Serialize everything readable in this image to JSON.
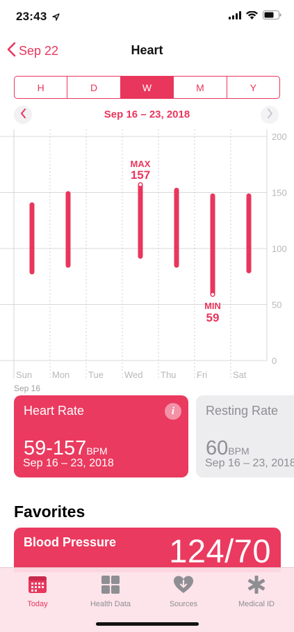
{
  "status_bar": {
    "time": "23:43",
    "icons": [
      "location-arrow-icon",
      "signal-bars-icon",
      "wifi-icon",
      "battery-icon"
    ]
  },
  "nav": {
    "back_label": "Sep 22",
    "title": "Heart"
  },
  "segments": [
    {
      "label": "H",
      "active": false
    },
    {
      "label": "D",
      "active": false
    },
    {
      "label": "W",
      "active": true
    },
    {
      "label": "M",
      "active": false
    },
    {
      "label": "Y",
      "active": false
    }
  ],
  "date_range": {
    "label": "Sep 16 – 23, 2018"
  },
  "accent_color": "#e8365d",
  "chart_data": {
    "type": "range-bar",
    "categories": [
      "Sun",
      "Mon",
      "Tue",
      "Wed",
      "Thu",
      "Fri",
      "Sat"
    ],
    "lows": [
      79,
      85,
      null,
      93,
      85,
      59,
      80
    ],
    "highs": [
      139,
      149,
      null,
      157,
      152,
      147,
      147
    ],
    "ylim": [
      0,
      200
    ],
    "yticks": [
      0,
      50,
      100,
      150,
      200
    ],
    "grid": true,
    "max_annotation": {
      "label": "MAX",
      "value": 157,
      "category": "Wed"
    },
    "min_annotation": {
      "label": "MIN",
      "value": 59,
      "category": "Fri"
    },
    "x_caption": "Sep 16"
  },
  "cards": {
    "heart_rate": {
      "title": "Heart Rate",
      "value": "59-157",
      "unit": "BPM",
      "date": "Sep 16 – 23, 2018",
      "info_icon": "info-icon"
    },
    "resting_rate": {
      "title": "Resting Rate",
      "value": "60",
      "unit": "BPM",
      "date": "Sep 16 – 23, 2018"
    }
  },
  "favorites": {
    "heading": "Favorites",
    "blood_pressure": {
      "title": "Blood Pressure",
      "value": "124/70"
    }
  },
  "tabs": [
    {
      "label": "Today",
      "icon": "today-calendar-icon",
      "active": true
    },
    {
      "label": "Health Data",
      "icon": "health-data-grid-icon",
      "active": false
    },
    {
      "label": "Sources",
      "icon": "sources-heart-icon",
      "active": false
    },
    {
      "label": "Medical ID",
      "icon": "medical-id-asterisk-icon",
      "active": false
    }
  ]
}
